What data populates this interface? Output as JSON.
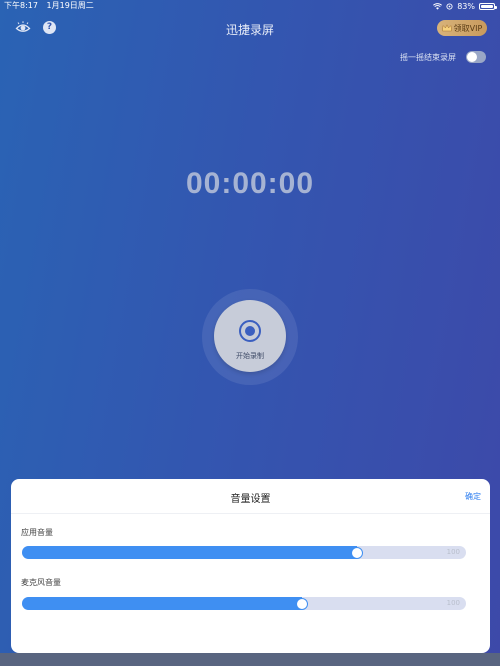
{
  "status_bar": {
    "time": "下午8:17",
    "date": "1月19日周二",
    "battery": "83%"
  },
  "header": {
    "title": "迅捷录屏",
    "vip_label": "领取VIP",
    "help_label": "?"
  },
  "shake_to_stop": {
    "label": "摇一摇结束录屏",
    "enabled": false
  },
  "timer": "00:00:00",
  "record_button_label": "开始录制",
  "volume_sheet": {
    "title": "音量设置",
    "confirm_label": "确定",
    "sliders": [
      {
        "label": "应用音量",
        "value": 0.755,
        "max_label": "100"
      },
      {
        "label": "麦克风音量",
        "value": 0.63,
        "max_label": "100"
      }
    ]
  },
  "colors": {
    "accent": "#3f8ff2",
    "background_start": "#2a63b4",
    "background_end": "#3d49a9",
    "vip": "#d8b37a"
  }
}
